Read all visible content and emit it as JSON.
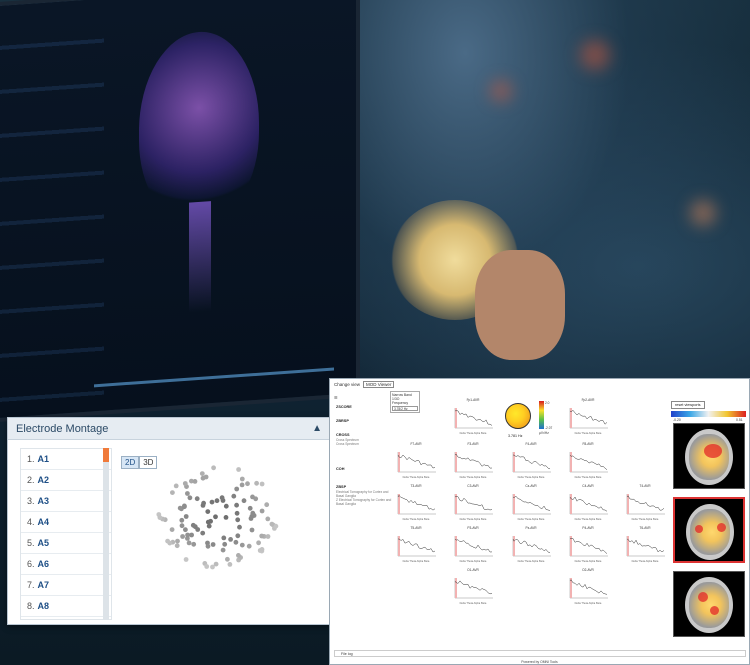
{
  "electrode_montage": {
    "title": "Electrode Montage",
    "view_2d": "2D",
    "view_3d": "3D",
    "items": [
      {
        "num": "1.",
        "label": "A1"
      },
      {
        "num": "2.",
        "label": "A2"
      },
      {
        "num": "3.",
        "label": "A3"
      },
      {
        "num": "4.",
        "label": "A4"
      },
      {
        "num": "5.",
        "label": "A5"
      },
      {
        "num": "6.",
        "label": "A6"
      },
      {
        "num": "7.",
        "label": "A7"
      },
      {
        "num": "8.",
        "label": "A8"
      }
    ]
  },
  "analysis": {
    "change_view_label": "Change view",
    "view_value": "MOD Viewer",
    "menu_icon": "hamburger-icon",
    "nav": [
      {
        "title": "ZSCORE",
        "subs": []
      },
      {
        "title": "ZBRSP",
        "subs": []
      },
      {
        "title": "CROSS",
        "subs": [
          "Cross Spectrum",
          "Cross Spectrum"
        ]
      },
      {
        "title": "COH",
        "subs": []
      },
      {
        "title": "ZBSP",
        "subs": [
          "Electrical Tomography for Cortex and Basal Ganglia",
          "Z Electrical Tomography for Cortex and Basal Ganglia"
        ]
      }
    ],
    "frequency": {
      "header": "Narrow Band 1/3O",
      "label": "Frequency",
      "value": "3.78/2 Hz"
    },
    "topo_value": "3.781 Hz",
    "colorbar": {
      "max": "2.0",
      "min": "-2.07",
      "unit": "µV²/Hz"
    },
    "reset_label": "reset viewports",
    "mri_scale": {
      "min": "-0.20",
      "max": "0.51"
    },
    "tiles": [
      {
        "title": "Fp1-AVR"
      },
      {
        "title": "Fp2-AVR"
      },
      {
        "title": "F7-AVR"
      },
      {
        "title": "F3-AVR"
      },
      {
        "title": "F4-AVR"
      },
      {
        "title": "F8-AVR"
      },
      {
        "title": "T3-AVR"
      },
      {
        "title": "C3-AVR"
      },
      {
        "title": "Cz-AVR"
      },
      {
        "title": "C4-AVR"
      },
      {
        "title": "T4-AVR"
      },
      {
        "title": "T5-AVR"
      },
      {
        "title": "P3-AVR"
      },
      {
        "title": "Pz-AVR"
      },
      {
        "title": "P4-AVR"
      },
      {
        "title": "T6-AVR"
      },
      {
        "title": "O1-AVR"
      },
      {
        "title": "O2-AVR"
      }
    ],
    "axis_caption": "Delta Theta Alpha Beta",
    "file_log": "File log",
    "status": "Powered by OMNI Tools"
  }
}
